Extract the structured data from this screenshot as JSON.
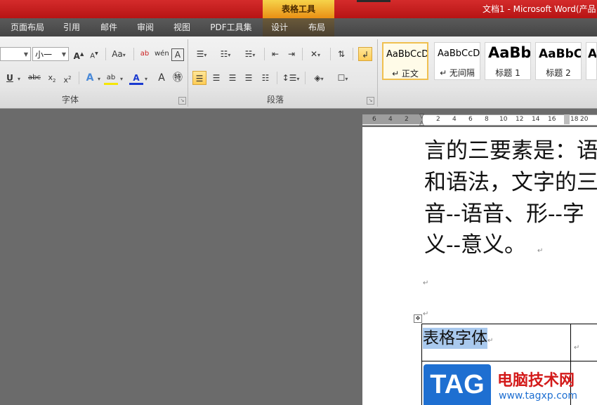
{
  "titlebar": {
    "contextual_label": "表格工具",
    "doc_title": "文档1  -  Microsoft Word(产品"
  },
  "tabs": [
    {
      "id": "layout",
      "label": "页面布局"
    },
    {
      "id": "references",
      "label": "引用"
    },
    {
      "id": "mailings",
      "label": "邮件"
    },
    {
      "id": "review",
      "label": "审阅"
    },
    {
      "id": "view",
      "label": "视图"
    },
    {
      "id": "pdf",
      "label": "PDF工具集"
    },
    {
      "id": "design",
      "label": "设计"
    },
    {
      "id": "table-layout",
      "label": "布局"
    }
  ],
  "font_group": {
    "label": "字体",
    "font_size": "小一"
  },
  "paragraph_group": {
    "label": "段落"
  },
  "styles": [
    {
      "sample": "AaBbCcD",
      "name": "↵ 正文"
    },
    {
      "sample": "AaBbCcD",
      "name": "↵ 无间隔"
    },
    {
      "sample": "AaBb",
      "name": "标题 1"
    },
    {
      "sample": "AaBbC",
      "name": "标题 2"
    },
    {
      "sample": "A",
      "name": ""
    }
  ],
  "ruler_ticks": [
    "6",
    "4",
    "2",
    "2",
    "4",
    "6",
    "8",
    "10",
    "12",
    "14",
    "16",
    "18",
    "20"
  ],
  "document": {
    "lines": [
      "言的三要素是：语",
      "和语法，文字的三",
      "音--语音、形--字",
      "义--意义。"
    ],
    "table_cell_text": "表格字体",
    "para_mark": "↵"
  },
  "watermark": {
    "logo": "TAG",
    "text": "电脑技术网",
    "url": "www.tagxp.com"
  },
  "colors": {
    "title_red": "#c41e1e",
    "contextual_orange": "#f0b030",
    "selection_blue": "#a9c9ee"
  }
}
